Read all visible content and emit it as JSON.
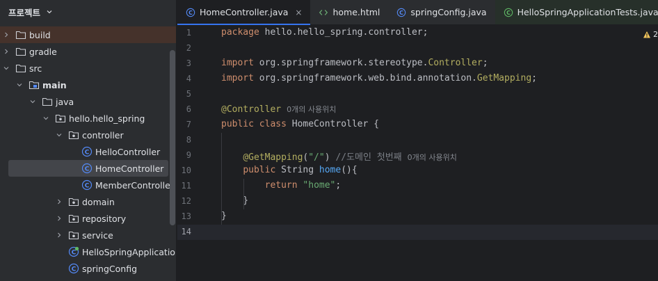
{
  "project_panel": {
    "title": "프로젝트",
    "tree": [
      {
        "label": "build",
        "level": 0,
        "arrow": "right",
        "icon": "folder-icon"
      },
      {
        "label": "gradle",
        "level": 0,
        "arrow": "right",
        "icon": "folder-icon"
      },
      {
        "label": "src",
        "level": 0,
        "arrow": "down",
        "icon": "folder-icon"
      },
      {
        "label": "main",
        "level": 1,
        "arrow": "down",
        "icon": "source-folder-icon"
      },
      {
        "label": "java",
        "level": 2,
        "arrow": "down",
        "icon": "folder-icon"
      },
      {
        "label": "hello.hello_spring",
        "level": 3,
        "arrow": "down",
        "icon": "package-icon"
      },
      {
        "label": "controller",
        "level": 4,
        "arrow": "down",
        "icon": "package-icon"
      },
      {
        "label": "HelloController",
        "level": 5,
        "arrow": "none",
        "icon": "class-icon"
      },
      {
        "label": "HomeController",
        "level": 5,
        "arrow": "none",
        "icon": "class-icon"
      },
      {
        "label": "MemberController",
        "level": 5,
        "arrow": "none",
        "icon": "class-icon"
      },
      {
        "label": "domain",
        "level": 4,
        "arrow": "right",
        "icon": "package-icon"
      },
      {
        "label": "repository",
        "level": 4,
        "arrow": "right",
        "icon": "package-icon"
      },
      {
        "label": "service",
        "level": 4,
        "arrow": "right",
        "icon": "package-icon"
      },
      {
        "label": "HelloSpringApplication",
        "level": 4,
        "arrow": "none",
        "icon": "spring-class-icon"
      },
      {
        "label": "springConfig",
        "level": 4,
        "arrow": "none",
        "icon": "class-icon"
      }
    ]
  },
  "tabs": [
    {
      "label": "HomeController.java",
      "icon": "class-icon",
      "active": true,
      "close": "×"
    },
    {
      "label": "home.html",
      "icon": "html-icon",
      "active": false
    },
    {
      "label": "springConfig.java",
      "icon": "class-icon",
      "active": false
    },
    {
      "label": "HelloSpringApplicationTests.java",
      "icon": "test-class-icon",
      "active": false
    }
  ],
  "editor": {
    "warning_count": "2",
    "lines": [
      {
        "num": "1",
        "tokens": [
          {
            "t": "package ",
            "c": "kw"
          },
          {
            "t": "hello.hello_spring.controller;",
            "c": ""
          }
        ]
      },
      {
        "num": "2",
        "tokens": []
      },
      {
        "num": "3",
        "tokens": [
          {
            "t": "import ",
            "c": "kw"
          },
          {
            "t": "org.springframework.stereotype.",
            "c": ""
          },
          {
            "t": "Controller",
            "c": "an"
          },
          {
            "t": ";",
            "c": ""
          }
        ]
      },
      {
        "num": "4",
        "tokens": [
          {
            "t": "import ",
            "c": "kw"
          },
          {
            "t": "org.springframework.web.bind.annotation.",
            "c": ""
          },
          {
            "t": "GetMapping",
            "c": "an"
          },
          {
            "t": ";",
            "c": ""
          }
        ]
      },
      {
        "num": "5",
        "tokens": []
      },
      {
        "num": "6",
        "tokens": [
          {
            "t": "@Controller",
            "c": "an"
          }
        ],
        "hint": "0개의 사용위치"
      },
      {
        "num": "7",
        "tokens": [
          {
            "t": "public class ",
            "c": "kw"
          },
          {
            "t": "HomeController ",
            "c": ""
          },
          {
            "t": "{",
            "c": ""
          }
        ]
      },
      {
        "num": "8",
        "tokens": []
      },
      {
        "num": "9",
        "tokens": [
          {
            "t": "    ",
            "c": ""
          },
          {
            "t": "@GetMapping",
            "c": "an"
          },
          {
            "t": "(",
            "c": ""
          },
          {
            "t": "\"/\"",
            "c": "str"
          },
          {
            "t": ") ",
            "c": ""
          },
          {
            "t": "//도메인 첫번째",
            "c": "cmt"
          }
        ],
        "hint": "0개의 사용위치"
      },
      {
        "num": "10",
        "tokens": [
          {
            "t": "    ",
            "c": ""
          },
          {
            "t": "public ",
            "c": "kw"
          },
          {
            "t": "String ",
            "c": ""
          },
          {
            "t": "home",
            "c": "ref"
          },
          {
            "t": "(){",
            "c": ""
          }
        ]
      },
      {
        "num": "11",
        "tokens": [
          {
            "t": "        ",
            "c": ""
          },
          {
            "t": "return ",
            "c": "kw"
          },
          {
            "t": "\"home\"",
            "c": "str"
          },
          {
            "t": ";",
            "c": ""
          }
        ]
      },
      {
        "num": "12",
        "tokens": [
          {
            "t": "    }",
            "c": ""
          }
        ]
      },
      {
        "num": "13",
        "tokens": [
          {
            "t": "}",
            "c": ""
          }
        ]
      },
      {
        "num": "14",
        "tokens": [],
        "current": true
      }
    ]
  }
}
